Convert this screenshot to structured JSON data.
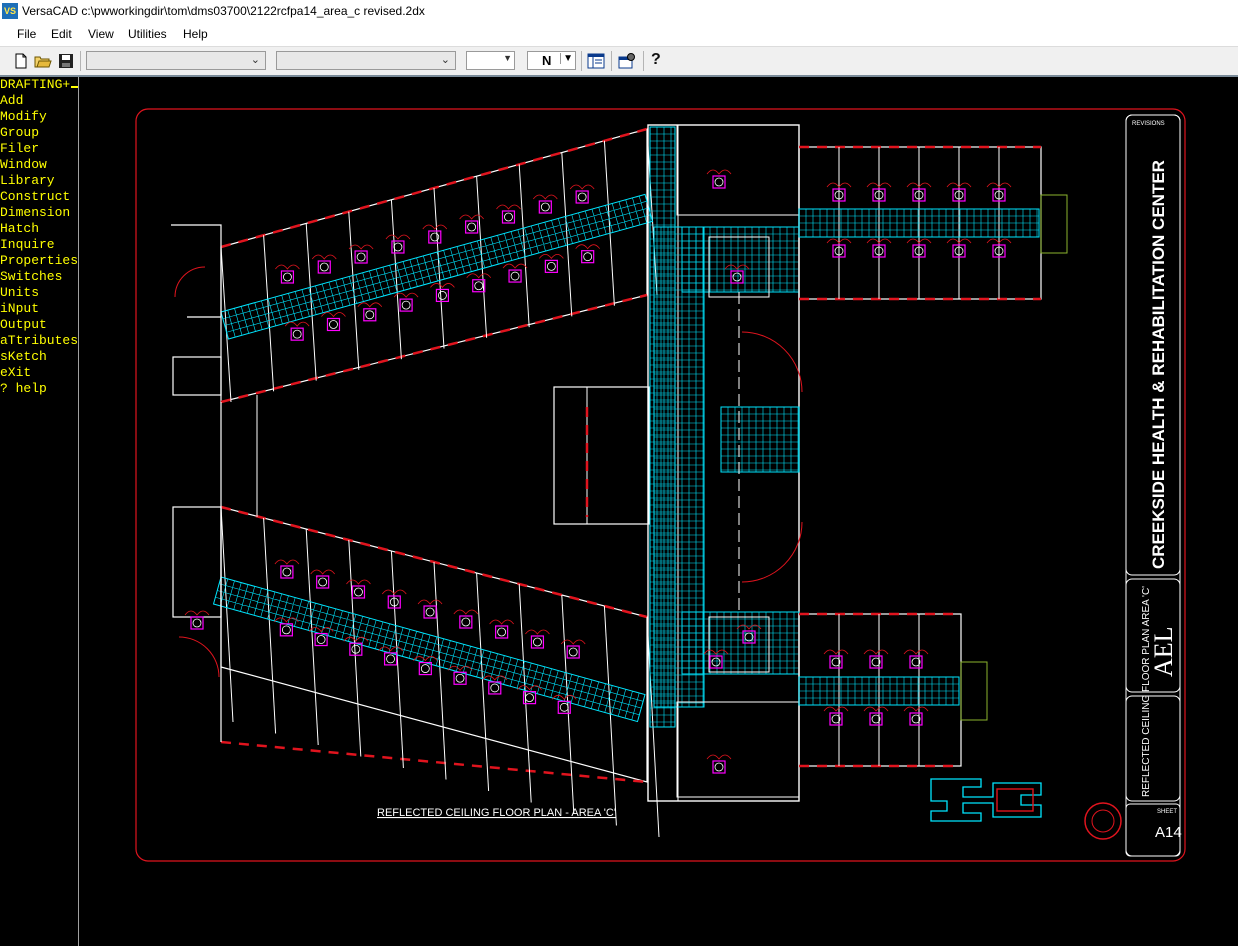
{
  "window": {
    "app_icon": "VS",
    "title": "VersaCAD  c:\\pwworkingdir\\tom\\dms03700\\2122rcfpa14_area_c revised.2dx"
  },
  "menubar": [
    "File",
    "Edit",
    "View",
    "Utilities",
    "Help"
  ],
  "toolbar": {
    "icons": [
      "new-file-icon",
      "open-folder-icon",
      "save-icon",
      "layers-icon",
      "properties-icon",
      "help-icon"
    ],
    "combo1_value": "",
    "combo2_value": "",
    "combo3_value": "",
    "n_field": "N",
    "help_glyph": "?"
  },
  "side_menu": {
    "items": [
      "DRAFTING+",
      "Add",
      "Modify",
      "Group",
      "Filer",
      "Window",
      "Library",
      "Construct",
      "Dimension",
      "Hatch",
      "Inquire",
      "Properties",
      "Switches",
      "Units",
      "iNput",
      "Output",
      "aTtributes",
      "sKetch",
      "eXit",
      "? help"
    ],
    "text_color": "#ffff00"
  },
  "drawing": {
    "plan_title": "REFLECTED CEILING FLOOR PLAN - AREA 'C'",
    "project_name": "CREEKSIDE HEALTH & REHABILITATION CENTER",
    "revisions_label": "REVISIONS",
    "firm_logo": "AEL",
    "sheet_title": "REFLECTED CEILING FLOOR PLAN AREA 'C'",
    "sheet_label": "SHEET",
    "sheet_number": "A14",
    "colors": {
      "border": "#e0141e",
      "walls": "#ffffff",
      "grid": "#00e6ff",
      "fixtures": "#ff00ff",
      "doors": "#e0141e"
    }
  }
}
